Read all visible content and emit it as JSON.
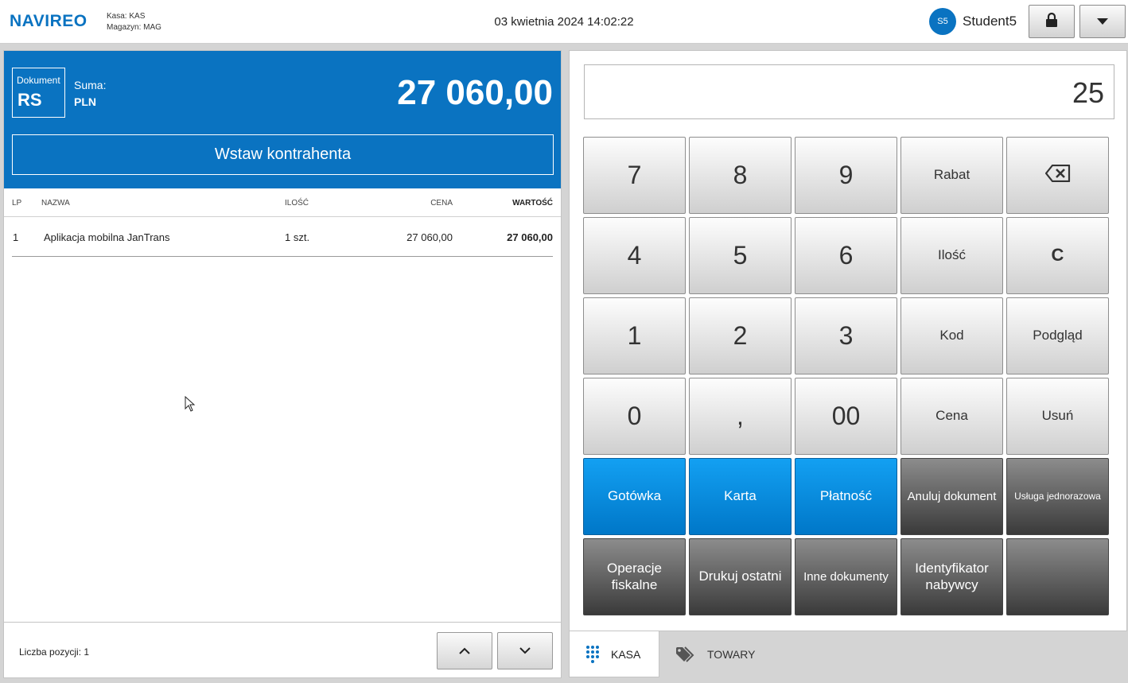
{
  "topbar": {
    "logo": "NAVIREO",
    "kasa_label": "Kasa:",
    "kasa_value": "KAS",
    "magazyn_label": "Magazyn:",
    "magazyn_value": "MAG",
    "datetime": "03 kwietnia 2024 14:02:22",
    "avatar_initials": "S5",
    "username": "Student5",
    "icons": {
      "lock": "lock-icon",
      "menu": "caret-down-icon"
    }
  },
  "document": {
    "label": "Dokument",
    "code": "RS",
    "sum_label": "Suma:",
    "currency": "PLN",
    "total": "27 060,00",
    "contractor_button": "Wstaw kontrahenta"
  },
  "table": {
    "headers": {
      "lp": "LP",
      "nazwa": "NAZWA",
      "ilosc": "ILOŚĆ",
      "cena": "CENA",
      "wartosc": "WARTOŚĆ"
    },
    "rows": [
      {
        "lp": "1",
        "nazwa": "Aplikacja mobilna JanTrans",
        "ilosc": "1 szt.",
        "cena": "27 060,00",
        "wartosc": "27 060,00"
      }
    ]
  },
  "footer": {
    "count_label": "Liczba pozycji:",
    "count_value": "1"
  },
  "keypad": {
    "display_value": "25",
    "keys": {
      "k7": "7",
      "k8": "8",
      "k9": "9",
      "rabat": "Rabat",
      "k4": "4",
      "k5": "5",
      "k6": "6",
      "ilosc": "Ilość",
      "clear": "C",
      "k1": "1",
      "k2": "2",
      "k3": "3",
      "kod": "Kod",
      "podglad": "Podgląd",
      "k0": "0",
      "comma": ",",
      "k00": "00",
      "cena": "Cena",
      "usun": "Usuń",
      "gotowka": "Gotówka",
      "karta": "Karta",
      "platnosc": "Płatność",
      "anuluj": "Anuluj dokument",
      "usluga": "Usługa jednorazowa",
      "operacje": "Operacje fiskalne",
      "drukuj": "Drukuj ostatni",
      "inne": "Inne dokumenty",
      "identyfikator": "Identyfikator nabywcy"
    }
  },
  "tabs": {
    "kasa": "KASA",
    "towary": "TOWARY"
  },
  "colors": {
    "accent": "#0a73c1",
    "payment_blue": "#0a8fe0",
    "dark_key": "#4a4a4a"
  }
}
